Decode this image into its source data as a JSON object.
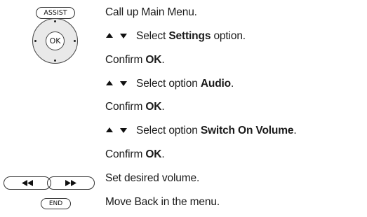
{
  "buttons": {
    "assist": "ASSIST",
    "ok": "OK",
    "end": "END"
  },
  "steps": [
    {
      "arrows": false,
      "pre": "Call up Main Menu.",
      "bold": "",
      "post": ""
    },
    {
      "arrows": true,
      "pre": "Select ",
      "bold": "Settings",
      "post": " option."
    },
    {
      "arrows": false,
      "pre": "Confirm ",
      "bold": "OK",
      "post": "."
    },
    {
      "arrows": true,
      "pre": "Select option ",
      "bold": "Audio",
      "post": "."
    },
    {
      "arrows": false,
      "pre": "Confirm ",
      "bold": "OK",
      "post": "."
    },
    {
      "arrows": true,
      "pre": "Select option ",
      "bold": "Switch On Volume",
      "post": "."
    },
    {
      "arrows": false,
      "pre": "Confirm ",
      "bold": "OK",
      "post": "."
    },
    {
      "arrows": false,
      "pre": "Set desired volume.",
      "bold": "",
      "post": ""
    },
    {
      "arrows": false,
      "pre": "Move Back in the menu.",
      "bold": "",
      "post": ""
    }
  ]
}
